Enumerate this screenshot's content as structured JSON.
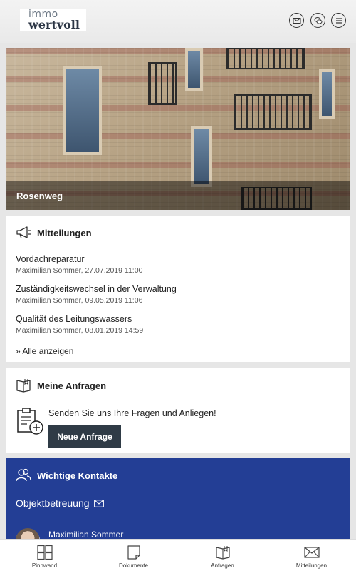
{
  "header": {
    "logo_line1": "immo",
    "logo_line2": "wertvoll",
    "icons": [
      "mail-icon",
      "chat-icon",
      "menu-icon"
    ]
  },
  "hero": {
    "title": "Rosenweg"
  },
  "mitteilungen": {
    "title": "Mitteilungen",
    "items": [
      {
        "title": "Vordachreparatur",
        "meta": "Maximilian Sommer, 27.07.2019 11:00"
      },
      {
        "title": "Zuständigkeitswechsel in der Verwaltung",
        "meta": "Maximilian Sommer, 09.05.2019 11:06"
      },
      {
        "title": "Qualität des Leitungswassers",
        "meta": "Maximilian Sommer, 08.01.2019 14:59"
      }
    ],
    "all_link": "» Alle anzeigen"
  },
  "anfragen": {
    "title": "Meine Anfragen",
    "text": "Senden Sie uns Ihre Fragen und Anliegen!",
    "button": "Neue Anfrage"
  },
  "kontakte": {
    "title": "Wichtige Kontakte",
    "subtitle": "Objektbetreuung",
    "contact_name": "Maximilian Sommer",
    "background": "#233e95"
  },
  "bottom_nav": [
    {
      "label": "Pinnwand",
      "icon": "grid-icon"
    },
    {
      "label": "Dokumente",
      "icon": "document-icon"
    },
    {
      "label": "Anfragen",
      "icon": "book-icon"
    },
    {
      "label": "Mitteilungen",
      "icon": "envelope-icon"
    }
  ]
}
